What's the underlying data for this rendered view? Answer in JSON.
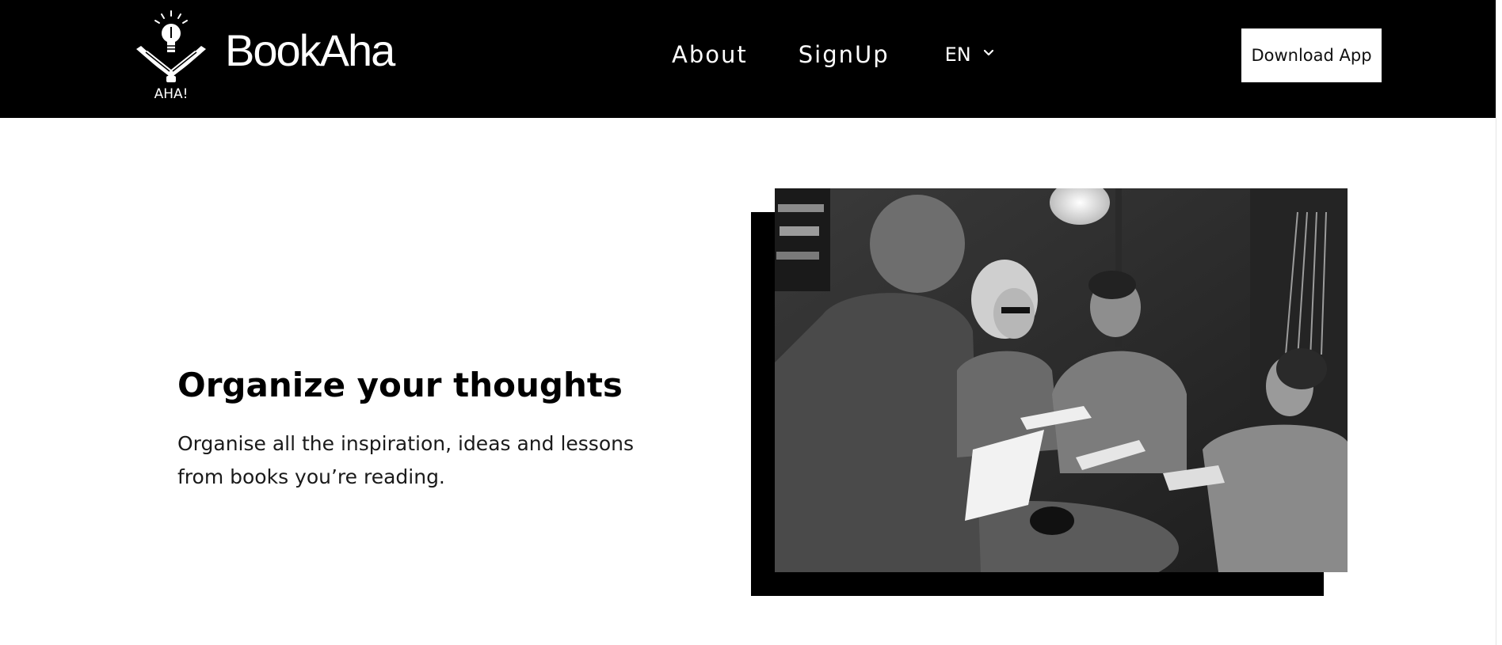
{
  "header": {
    "brand_name": "BookAha",
    "logo_caption": "AHA!",
    "nav": {
      "about": "About",
      "signup": "SignUp",
      "language": "EN"
    },
    "download_label": "Download App"
  },
  "hero": {
    "title": "Organize your thoughts",
    "description": "Organise all the inspiration, ideas and lessons from books you’re reading."
  },
  "colors": {
    "header_bg": "#000000",
    "page_bg": "#ffffff",
    "button_bg": "#ffffff"
  },
  "icons": {
    "logo": "lightbulb-book-icon",
    "language_toggle": "chevron-down-icon"
  }
}
